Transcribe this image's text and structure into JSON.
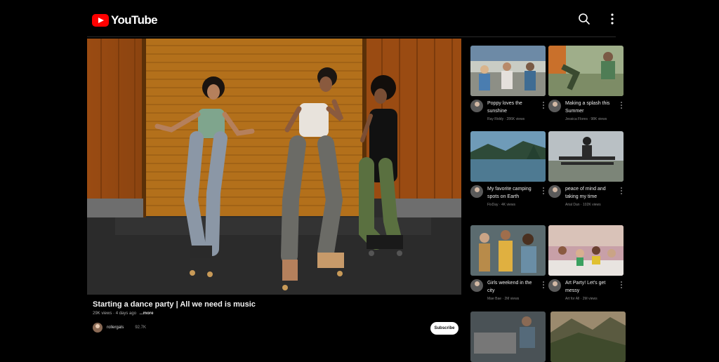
{
  "app": {
    "logo_text": "YouTube"
  },
  "header": {
    "search_icon": "search-icon",
    "more_icon": "more-vert-icon"
  },
  "colors": {
    "brand": "#ff0000",
    "background": "#000000",
    "subscribe_bg": "#ffffff"
  },
  "video": {
    "title": "Starting a dance party | All we need is music",
    "views": "29K views",
    "age": "4 days ago",
    "more_label": "...more",
    "channel": "rollergals",
    "subscribers": "92.7K",
    "subscribe_label": "Subscribe"
  },
  "sidebar": {
    "items": [
      {
        "title_1": "Poppy loves the",
        "title_2": "sunshine",
        "channel": "Ray Riddy",
        "views": "286K views"
      },
      {
        "title_1": "Making a splash this",
        "title_2": "Summer",
        "channel": "Jessica Flores",
        "views": "98K views"
      },
      {
        "title_1": "My favorite camping",
        "title_2": "spots on Earth",
        "channel": "FixDay",
        "views": "4K views"
      },
      {
        "title_1": "peace of mind and",
        "title_2": "taking my time",
        "channel": "Arial Dan",
        "views": "102K views"
      },
      {
        "title_1": "Girls weekend in the",
        "title_2": "city",
        "channel": "Mae Bae",
        "views": "2M views"
      },
      {
        "title_1": "Art Party! Let's get",
        "title_2": "messy",
        "channel": "Art for All",
        "views": "2M views"
      }
    ]
  }
}
